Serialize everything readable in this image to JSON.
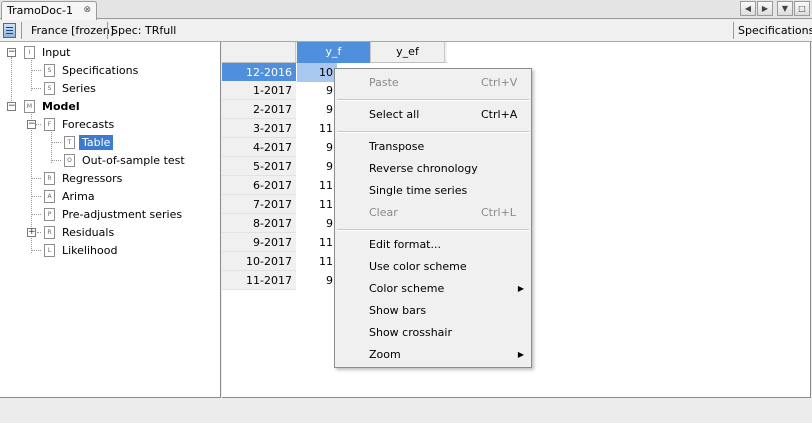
{
  "tab": {
    "title": "TramoDoc-1",
    "close_icon": "close-icon"
  },
  "toolbar": {
    "doc_icon": "document-icon",
    "info": "France [frozen]",
    "spec": "Spec: TRfull",
    "specifications_button": "Specifications"
  },
  "tree": {
    "items": [
      {
        "label": "Input",
        "icon_letter": "I"
      },
      {
        "label": "Specifications",
        "icon_letter": "S"
      },
      {
        "label": "Series",
        "icon_letter": "S"
      },
      {
        "label": "Model",
        "icon_letter": "M"
      },
      {
        "label": "Forecasts",
        "icon_letter": "F"
      },
      {
        "label": "Table",
        "icon_letter": "T"
      },
      {
        "label": "Out-of-sample test",
        "icon_letter": "O"
      },
      {
        "label": "Regressors",
        "icon_letter": "R"
      },
      {
        "label": "Arima",
        "icon_letter": "A"
      },
      {
        "label": "Pre-adjustment series",
        "icon_letter": "P"
      },
      {
        "label": "Residuals",
        "icon_letter": "R"
      },
      {
        "label": "Likelihood",
        "icon_letter": "L"
      }
    ]
  },
  "table": {
    "columns": [
      "y_f",
      "y_ef"
    ],
    "rows": [
      {
        "period": "12-2016",
        "y_f": "10"
      },
      {
        "period": "1-2017",
        "y_f": "9"
      },
      {
        "period": "2-2017",
        "y_f": "9"
      },
      {
        "period": "3-2017",
        "y_f": "11"
      },
      {
        "period": "4-2017",
        "y_f": "9"
      },
      {
        "period": "5-2017",
        "y_f": "9"
      },
      {
        "period": "6-2017",
        "y_f": "11"
      },
      {
        "period": "7-2017",
        "y_f": "11"
      },
      {
        "period": "8-2017",
        "y_f": "9"
      },
      {
        "period": "9-2017",
        "y_f": "11"
      },
      {
        "period": "10-2017",
        "y_f": "11"
      },
      {
        "period": "11-2017",
        "y_f": "9"
      }
    ]
  },
  "context_menu": {
    "paste": "Paste",
    "paste_shortcut": "Ctrl+V",
    "select_all": "Select all",
    "select_all_shortcut": "Ctrl+A",
    "transpose": "Transpose",
    "reverse_chronology": "Reverse chronology",
    "single_time_series": "Single time series",
    "clear": "Clear",
    "clear_shortcut": "Ctrl+L",
    "edit_format": "Edit format...",
    "use_color_scheme": "Use color scheme",
    "color_scheme": "Color scheme",
    "show_bars": "Show bars",
    "show_crosshair": "Show crosshair",
    "zoom": "Zoom"
  },
  "colors": {
    "selection": "#3d7bd1",
    "header_active": "#4f8fdc",
    "cell_active": "#a9c8ef"
  }
}
